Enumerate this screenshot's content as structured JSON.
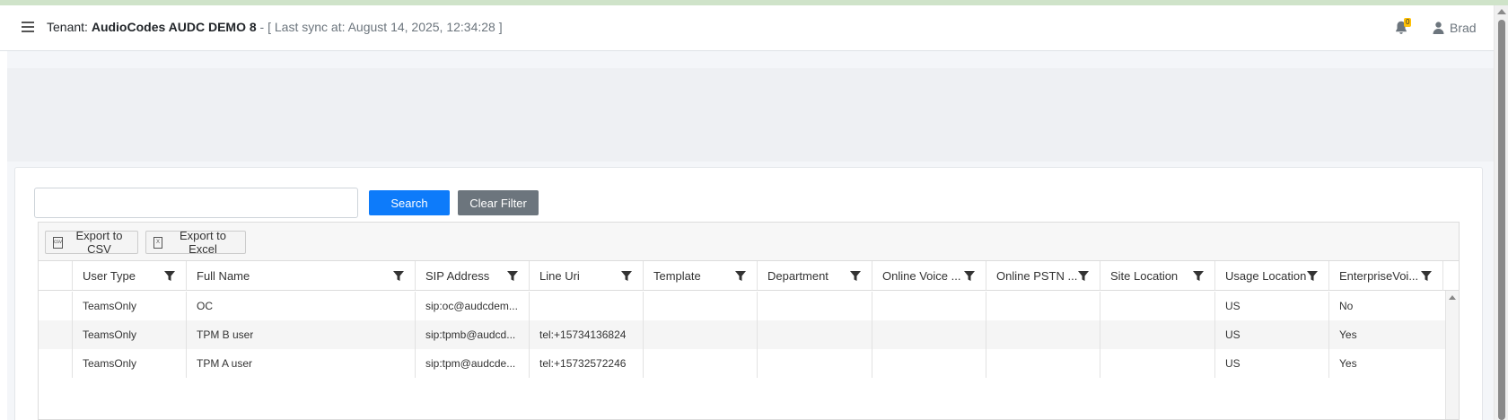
{
  "header": {
    "tenant_prefix": "Tenant: ",
    "tenant_name": "AudioCodes AUDC DEMO 8",
    "sync_text": " - [ Last sync at: August 14, 2025, 12:34:28 ]",
    "notification_count": "0",
    "user_name": "Brad"
  },
  "search": {
    "value": "",
    "search_label": "Search",
    "clear_label": "Clear Filter"
  },
  "toolbar": {
    "csv_label": "Export to CSV",
    "excel_label": "Export to Excel"
  },
  "table": {
    "columns": [
      "User Type",
      "Full Name",
      "SIP Address",
      "Line Uri",
      "Template",
      "Department",
      "Online Voice ...",
      "Online PSTN ...",
      "Site Location",
      "Usage Location",
      "EnterpriseVoi..."
    ],
    "rows": [
      [
        "TeamsOnly",
        "OC",
        "sip:oc@audcdem...",
        "",
        "",
        "",
        "",
        "",
        "",
        "US",
        "No"
      ],
      [
        "TeamsOnly",
        "TPM B user",
        "sip:tpmb@audcd...",
        "tel:+15734136824",
        "",
        "",
        "",
        "",
        "",
        "US",
        "Yes"
      ],
      [
        "TeamsOnly",
        "TPM A user",
        "sip:tpm@audcde...",
        "tel:+15732572246",
        "",
        "",
        "",
        "",
        "",
        "US",
        "Yes"
      ]
    ]
  },
  "colors": {
    "primary": "#0d7bfa",
    "secondary": "#6c757d",
    "badge": "#ffc107"
  }
}
